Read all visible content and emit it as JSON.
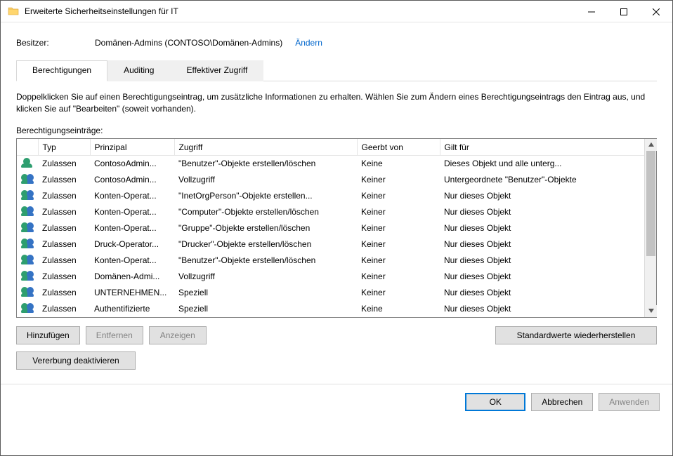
{
  "window": {
    "title": "Erweiterte Sicherheitseinstellungen für IT"
  },
  "owner": {
    "label": "Besitzer:",
    "value": "Domänen-Admins (CONTOSO\\Domänen-Admins)",
    "change_link": "Ändern"
  },
  "tabs": [
    {
      "id": "permissions",
      "label": "Berechtigungen",
      "active": true
    },
    {
      "id": "auditing",
      "label": "Auditing",
      "active": false
    },
    {
      "id": "effective",
      "label": "Effektiver Zugriff",
      "active": false
    }
  ],
  "help_text": "Doppelklicken Sie auf einen Berechtigungseintrag, um zusätzliche Informationen zu erhalten. Wählen Sie zum Ändern eines Berechtigungseintrags den Eintrag aus, und klicken Sie auf \"Bearbeiten\" (soweit vorhanden).",
  "entries_label": "Berechtigungseinträge:",
  "columns": {
    "type": "Typ",
    "principal": "Prinzipal",
    "access": "Zugriff",
    "inherited": "Geerbt von",
    "applies": "Gilt für"
  },
  "entries": [
    {
      "icon": "single",
      "type": "Zulassen",
      "principal": "ContosoAdmin...",
      "access": "\"Benutzer\"-Objekte erstellen/löschen",
      "inherited": "Keine",
      "applies": "Dieses Objekt und alle unterg..."
    },
    {
      "icon": "multi",
      "type": "Zulassen",
      "principal": "ContosoAdmin...",
      "access": "Vollzugriff",
      "inherited": "Keiner",
      "applies": "Untergeordnete \"Benutzer\"-Objekte"
    },
    {
      "icon": "multi",
      "type": "Zulassen",
      "principal": "Konten-Operat...",
      "access": "\"InetOrgPerson\"-Objekte erstellen...",
      "inherited": "Keiner",
      "applies": "Nur dieses Objekt"
    },
    {
      "icon": "multi",
      "type": "Zulassen",
      "principal": "Konten-Operat...",
      "access": "\"Computer\"-Objekte erstellen/löschen",
      "inherited": "Keiner",
      "applies": "Nur dieses Objekt"
    },
    {
      "icon": "multi",
      "type": "Zulassen",
      "principal": "Konten-Operat...",
      "access": "\"Gruppe\"-Objekte erstellen/löschen",
      "inherited": "Keiner",
      "applies": "Nur dieses Objekt"
    },
    {
      "icon": "multi",
      "type": "Zulassen",
      "principal": "Druck-Operator...",
      "access": "\"Drucker\"-Objekte erstellen/löschen",
      "inherited": "Keiner",
      "applies": "Nur dieses Objekt"
    },
    {
      "icon": "multi",
      "type": "Zulassen",
      "principal": "Konten-Operat...",
      "access": "\"Benutzer\"-Objekte erstellen/löschen",
      "inherited": "Keiner",
      "applies": "Nur dieses Objekt"
    },
    {
      "icon": "multi",
      "type": "Zulassen",
      "principal": "Domänen-Admi...",
      "access": "Vollzugriff",
      "inherited": "Keiner",
      "applies": "Nur dieses Objekt"
    },
    {
      "icon": "multi",
      "type": "Zulassen",
      "principal": "UNTERNEHMEN...",
      "access": "Speziell",
      "inherited": "Keiner",
      "applies": "Nur dieses Objekt"
    },
    {
      "icon": "multi",
      "type": "Zulassen",
      "principal": "Authentifizierte",
      "access": "Speziell",
      "inherited": "Keine",
      "applies": "Nur dieses Objekt"
    }
  ],
  "buttons": {
    "add": "Hinzufügen",
    "remove": "Entfernen",
    "view": "Anzeigen",
    "restore_defaults": "Standardwerte wiederherstellen",
    "disable_inheritance": "Vererbung deaktivieren",
    "ok": "OK",
    "cancel": "Abbrechen",
    "apply": "Anwenden"
  }
}
